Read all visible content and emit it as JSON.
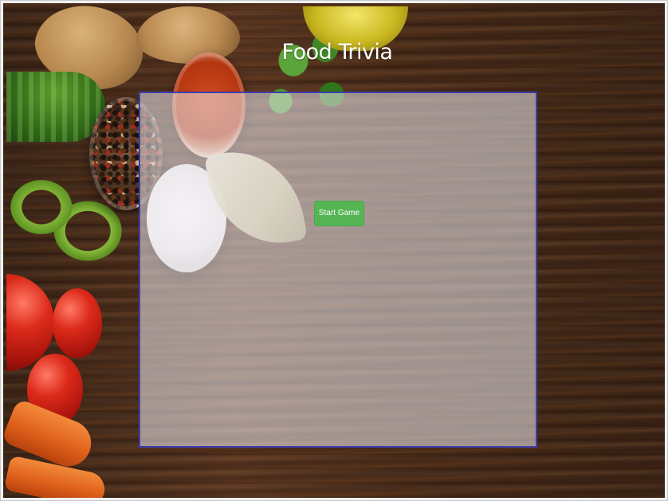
{
  "page": {
    "title": "Food Trivia"
  },
  "game": {
    "start_button_label": "Start Game"
  },
  "colors": {
    "panel_border": "#3d3db0",
    "button_bg": "#55b555",
    "title_text": "#ffffff"
  }
}
